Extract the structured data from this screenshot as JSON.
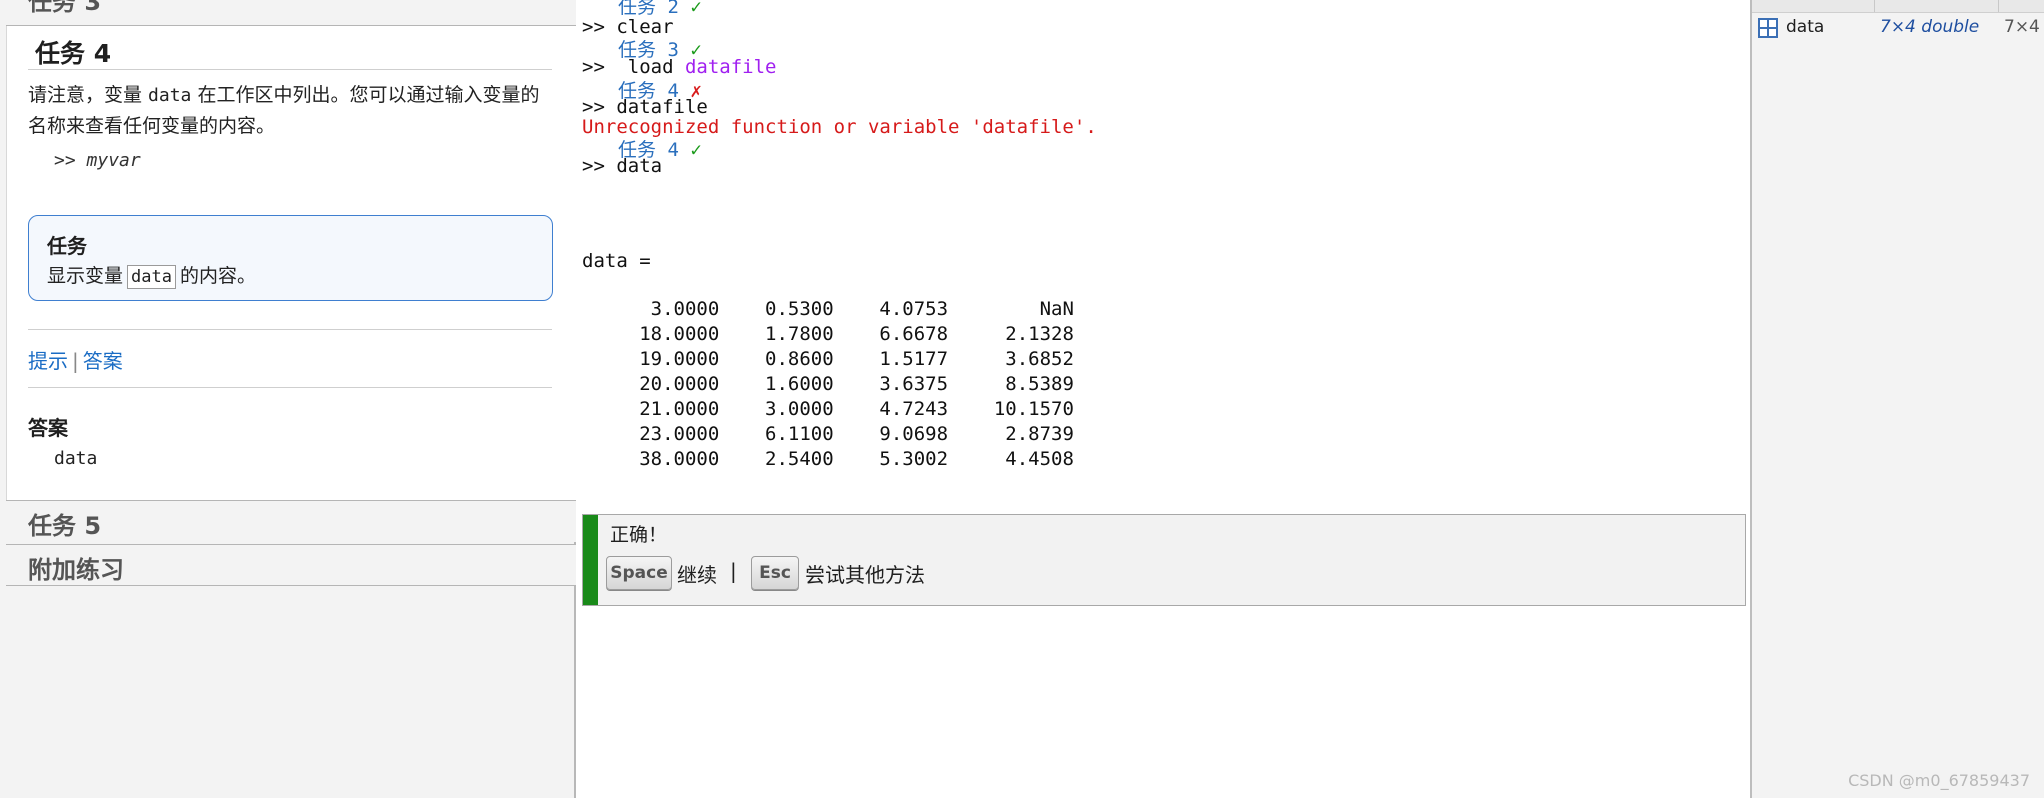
{
  "left_panel": {
    "task3_title": "任务 3",
    "task4_title": "任务 4",
    "desc_part1": "请注意，变量 ",
    "desc_code": "data",
    "desc_part2": " 在工作区中列出。您可以通过输入变量的名称来查看任何变量的内容。",
    "example_prompt": ">> ",
    "example_var": "myvar",
    "task_box_title": "任务",
    "task_box_text_pre": "显示变量",
    "task_box_code": "data",
    "task_box_text_post": "的内容。",
    "hint_link": "提示",
    "link_separator": "|",
    "answer_link": "答案",
    "answer_title": "答案",
    "answer_code": "data",
    "task5_title": "任务 5",
    "extra_title": "附加练习"
  },
  "command_window": {
    "lines": [
      {
        "kind": "task",
        "text": "任务 2",
        "mark": "✓",
        "status": "ok"
      },
      {
        "kind": "cmd",
        "prompt": ">> ",
        "text": "clear"
      },
      {
        "kind": "task",
        "text": "任务 3",
        "mark": "✓",
        "status": "ok"
      },
      {
        "kind": "cmd",
        "prompt": ">>  ",
        "text": "load ",
        "arg": "datafile"
      },
      {
        "kind": "task",
        "text": "任务 4",
        "mark": "✗",
        "status": "bad"
      },
      {
        "kind": "cmd",
        "prompt": ">> ",
        "text": "datafile"
      },
      {
        "kind": "error",
        "text": "Unrecognized function or variable 'datafile'."
      },
      {
        "kind": "task",
        "text": "任务 4",
        "mark": "✓",
        "status": "ok"
      },
      {
        "kind": "cmd",
        "prompt": ">> ",
        "text": "data"
      }
    ],
    "result_header": "data =",
    "table_rows": [
      [
        "3.0000",
        "0.5300",
        "4.0753",
        "NaN"
      ],
      [
        "18.0000",
        "1.7800",
        "6.6678",
        "2.1328"
      ],
      [
        "19.0000",
        "0.8600",
        "1.5177",
        "3.6852"
      ],
      [
        "20.0000",
        "1.6000",
        "3.6375",
        "8.5389"
      ],
      [
        "21.0000",
        "3.0000",
        "4.7243",
        "10.1570"
      ],
      [
        "23.0000",
        "6.1100",
        "9.0698",
        "2.8739"
      ],
      [
        "38.0000",
        "2.5400",
        "5.3002",
        "4.4508"
      ]
    ]
  },
  "feedback": {
    "correct_text": "正确！",
    "space_key": "Space",
    "continue_label": "继续",
    "separator": "|",
    "esc_key": "Esc",
    "other_label": "尝试其他方法",
    "bar_color": "#198a19"
  },
  "workspace": {
    "var_name": "data",
    "var_value": "7×4 double",
    "var_size": "7×4"
  },
  "watermark": "CSDN @m0_67859437"
}
